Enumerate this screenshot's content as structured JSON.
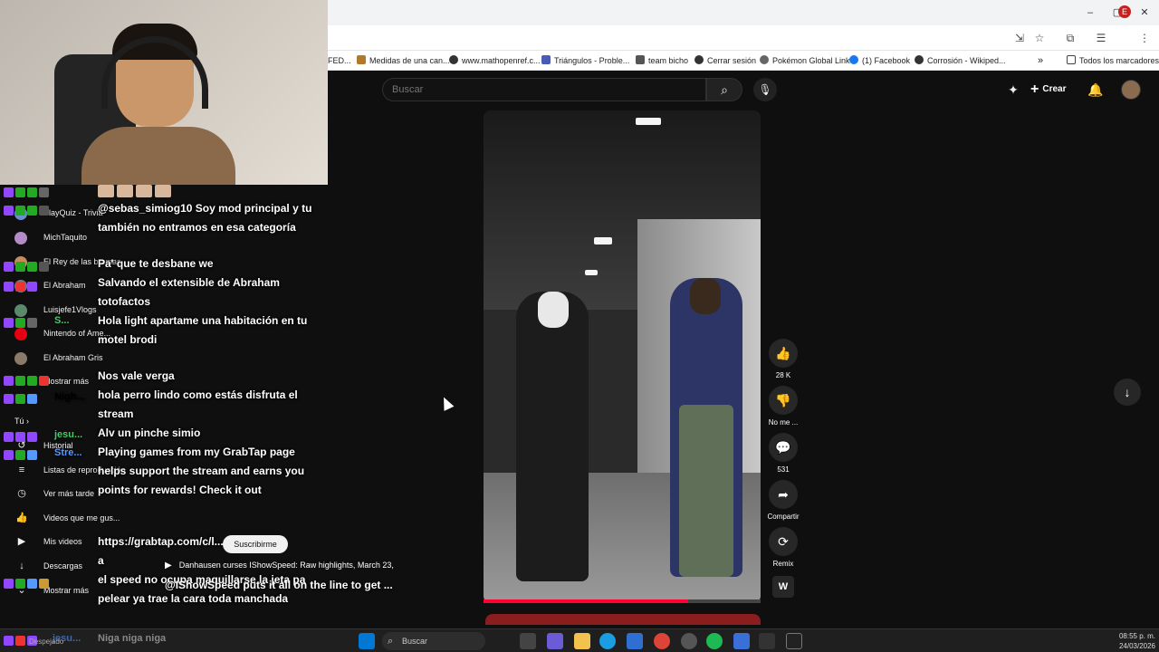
{
  "window": {
    "controls": [
      "–",
      "▢",
      "✕"
    ]
  },
  "addressbar": {
    "icons": [
      "install-icon",
      "star-icon",
      "extensions-icon",
      "reading-list-icon",
      "profile-icon",
      "more-icon"
    ],
    "profile_letter": "E"
  },
  "bookmarks": {
    "items": [
      {
        "label": "FED...",
        "icon_color": "#999999"
      },
      {
        "label": "Medidas de una can...",
        "icon_color": "#b07a2a"
      },
      {
        "label": "www.mathopenref.c...",
        "icon_color": "#333333"
      },
      {
        "label": "Triángulos - Proble...",
        "icon_color": "#4a5bb5"
      },
      {
        "label": "team bicho",
        "icon_color": "#555555"
      },
      {
        "label": "Cerrar sesión",
        "icon_color": "#333333"
      },
      {
        "label": "Pokémon Global Link",
        "icon_color": "#666666"
      },
      {
        "label": "(1) Facebook",
        "icon_color": "#1877f2"
      },
      {
        "label": "Corrosión - Wikiped...",
        "icon_color": "#333333"
      }
    ],
    "overflow": "»",
    "all_bookmarks": "Todos los marcadores"
  },
  "youtube": {
    "search_placeholder": "Buscar",
    "create_label": "Crear",
    "sidebar": {
      "subscriptions": [
        {
          "name": "PlayQuiz - Trivia",
          "color": "#6a8fd1"
        },
        {
          "name": "MichTaquito",
          "color": "#b48ac7"
        },
        {
          "name": "El Rey de las bromas",
          "color": "#c78a5a"
        },
        {
          "name": "El Abraham",
          "color": "#7a7a7a"
        },
        {
          "name": "Luisjefe1Vlogs",
          "color": "#5a8a6a"
        },
        {
          "name": "Nintendo of Ame...",
          "color": "#e60012"
        },
        {
          "name": "El Abraham Gris",
          "color": "#8a7a6a"
        }
      ],
      "show_more_1": "Mostrar más",
      "you_label": "Tú",
      "you_chevron": "›",
      "you_items": [
        {
          "icon": "history-icon",
          "glyph": "↺",
          "label": "Historial"
        },
        {
          "icon": "playlists-icon",
          "glyph": "≡",
          "label": "Listas de reproducción"
        },
        {
          "icon": "watch-later-icon",
          "glyph": "◷",
          "label": "Ver más tarde"
        },
        {
          "icon": "liked-icon",
          "glyph": "👍",
          "label": "Videos que me gus..."
        },
        {
          "icon": "your-videos-icon",
          "glyph": "▶",
          "label": "Mis videos"
        },
        {
          "icon": "downloads-icon",
          "glyph": "↓",
          "label": "Descargas"
        }
      ],
      "show_more_2": "Mostrar más"
    },
    "short": {
      "likes": "28 K",
      "dislike_label": "No me ...",
      "comments": "531",
      "share_label": "Compartir",
      "remix_label": "Remix",
      "progress": 0.74
    },
    "now_playing": {
      "title": "Danhausen curses IShowSpeed: Raw highlights, March 23,",
      "subtitle": "@IShowSpeed puts it all on the line to get ...",
      "tooltip": "Suscribirme"
    }
  },
  "chat": {
    "users": [
      {
        "name": "S...",
        "color": "#d43"
      },
      {
        "name": "Nigh...",
        "color": "#59f"
      },
      {
        "name": "jesu...",
        "color": "#4c6"
      },
      {
        "name": "Stre...",
        "color": "#59f"
      }
    ],
    "messages": [
      "@sebas_simiog10 Soy mod principal y tu también no entramos en esa categoría",
      "Pa' que te desbane we",
      "Salvando el extensible de Abraham totofactos",
      "Hola light apartame una habitación en tu motel brodi",
      "Nos vale verga",
      "hola perro lindo como estás disfruta el stream",
      "Alv un pinche simio",
      "Playing games from my GrabTap page helps support the stream and earns you points for rewards! Check it out",
      "https://grabtap.com/c/l...",
      "a",
      "el speed no ocupa maquillarse la jeta pa pelear ya trae la cara toda manchada"
    ],
    "input_user": "jesu...",
    "input_text": "Niga niga niga",
    "input_sub": "Despejado"
  },
  "taskbar": {
    "search": "Buscar",
    "time": "08:55 p. m.",
    "date": "24/03/2026"
  }
}
